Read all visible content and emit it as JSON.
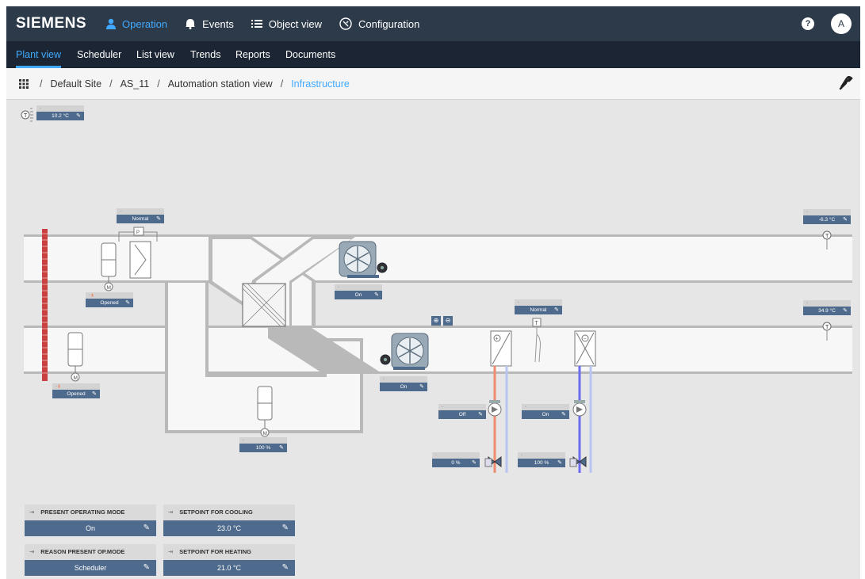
{
  "brand": "SIEMENS",
  "topnav": {
    "operation": "Operation",
    "events": "Events",
    "object_view": "Object view",
    "configuration": "Configuration",
    "user_initial": "A",
    "help": "?"
  },
  "subnav": {
    "plant_view": "Plant view",
    "scheduler": "Scheduler",
    "list_view": "List view",
    "trends": "Trends",
    "reports": "Reports",
    "documents": "Documents"
  },
  "breadcrumb": {
    "sep": "/",
    "site": "Default Site",
    "station": "AS_11",
    "station_view": "Automation station view",
    "current": "Infrastructure"
  },
  "chips": {
    "outside_temp": "10.2 °C",
    "filter_status": "Normal",
    "damper_top": "Opened",
    "damper_bottom": "Opened",
    "exhaust_fan": "On",
    "supply_fan": "On",
    "bypass_damper": "100 %",
    "frost_status": "Normal",
    "exhaust_temp": "-6.3 °C",
    "supply_temp": "34.9 °C",
    "heat_pump": "Off",
    "heat_valve": "0 %",
    "cool_pump": "On",
    "cool_valve": "100 %"
  },
  "panels": {
    "present_mode_label": "PRESENT OPERATING MODE",
    "present_mode_value": "On",
    "cool_setpoint_label": "SETPOINT FOR COOLING",
    "cool_setpoint_value": "23.0 °C",
    "reason_label": "REASON PRESENT OP.MODE",
    "reason_value": "Scheduler",
    "heat_setpoint_label": "SETPOINT FOR HEATING",
    "heat_setpoint_value": "21.0 °C"
  },
  "colors": {
    "topbar": "#2d3a4a",
    "subnav": "#1b2533",
    "accent": "#41aaff",
    "value_bg": "#4e6a8c",
    "heating_pipe": "#f08c6e",
    "cooling_pipe": "#6b6bf0"
  },
  "icons": {
    "operation": "person-icon",
    "events": "bell-icon",
    "object_view": "list-icon",
    "configuration": "config-icon",
    "grid": "grid-icon",
    "wrench": "wrench-icon"
  }
}
